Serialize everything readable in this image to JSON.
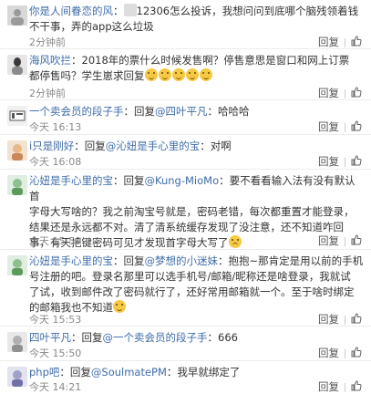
{
  "comments": [
    {
      "user": "你是人间眷恋的风",
      "prefix": "：",
      "reply_label": "",
      "mention": "",
      "text_lines": [
        "12306怎么投诉，我想问问到底哪个脑残领着钱",
        "不干事，弄的app这么垃圾"
      ],
      "time": "2分钟前",
      "reply_btn": "回复",
      "has_like": true,
      "like_count": ""
    },
    {
      "user": "海风吹拦",
      "prefix": "：2018年的票什么时候发售啊？停售意思是窗口和网上订票",
      "reply_label": "",
      "mention": "",
      "text_lines": [
        "都停售吗？学生崽求回复"
      ],
      "time": "2分钟前",
      "reply_btn": "回复",
      "has_like": true,
      "like_count": ""
    },
    {
      "user": "一个卖会员的段子手",
      "prefix": "：回复",
      "reply_label": "回复",
      "mention": "@四叶平凡",
      "text_lines": [
        "：哈哈哈"
      ],
      "time": "今天 16:13",
      "reply_btn": "回复",
      "has_like": true,
      "like_count": ""
    },
    {
      "user": "i只是刚好",
      "prefix": "：回复",
      "reply_label": "回复",
      "mention": "@沁妞是手心里的宝",
      "text_lines": [
        "：对啊"
      ],
      "time": "今天 16:08",
      "reply_btn": "回复",
      "has_like": true,
      "like_count": ""
    },
    {
      "user": "沁妞是手心里的宝",
      "prefix": "：回复",
      "reply_label": "回复",
      "mention": "@Kung-MioMo",
      "text_lines": [
        "：要不看看输入法有没有默认首",
        "字母大写啥的？我之前淘宝号就是，密码老错，每次都重置才能登录，",
        "结果还是永远都不对。清了清系统缓存发现了没注意，还不知道咋回",
        "事，有天把键密码可见才发现首字母大写了"
      ],
      "time": "今天 15:59",
      "reply_btn": "回复",
      "has_like": true,
      "like_count": ""
    },
    {
      "user": "沁妞是手心里的宝",
      "prefix": "：回复",
      "reply_label": "回复",
      "mention": "@梦想的小迷妹",
      "text_lines": [
        "：抱抱~那肯定是用以前的手机",
        "号注册的吧。登录名那里可以选手机号/邮箱/昵称还是啥登录，我就试",
        "了试，收到邮件改了密码就行了，还好常用邮箱就一个。至于啥时绑定",
        "的邮箱我也不知道"
      ],
      "time": "今天 15:53",
      "reply_btn": "回复",
      "has_like": true,
      "like_count": ""
    },
    {
      "user": "四叶平凡",
      "prefix": "：回复",
      "reply_label": "回复",
      "mention": "@一个卖会员的段子手",
      "text_lines": [
        "：666"
      ],
      "time": "今天 15:50",
      "reply_btn": "回复",
      "has_like": true,
      "like_count": ""
    },
    {
      "user": "php吧",
      "prefix": "：回复",
      "reply_label": "回复",
      "mention": "@SoulmatePM",
      "text_lines": [
        "：我早就绑定了"
      ],
      "time": "今天 14:21",
      "reply_btn": "回复",
      "has_like": true,
      "like_count": ""
    }
  ],
  "colors": {
    "username": "#3e6ca8",
    "text": "#333333",
    "time": "#888888",
    "divider": "#ececec"
  }
}
